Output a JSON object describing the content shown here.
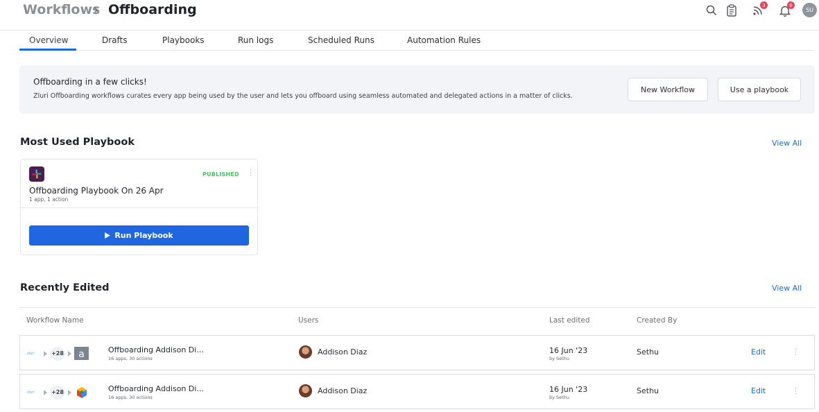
{
  "breadcrumb": {
    "root": "Workflows",
    "separator": "›",
    "current": "Offboarding"
  },
  "header": {
    "icons": [
      "search-icon",
      "clipboard-icon",
      "feed-icon",
      "bell-icon"
    ],
    "feed_badge": "3",
    "bell_badge": "6",
    "avatar_initials": "SU"
  },
  "tabs": [
    {
      "label": "Overview",
      "active": true
    },
    {
      "label": "Drafts"
    },
    {
      "label": "Playbooks"
    },
    {
      "label": "Run logs"
    },
    {
      "label": "Scheduled Runs"
    },
    {
      "label": "Automation Rules"
    }
  ],
  "banner": {
    "title": "Offboarding in a few clicks!",
    "description": "Zluri Offboarding workflows curates every app being used by the user and lets you offboard using seamless automated and delegated actions in a matter of clicks.",
    "new_workflow": "New Workflow",
    "use_playbook": "Use a playbook"
  },
  "most_used": {
    "title": "Most Used Playbook",
    "view_all": "View All",
    "card": {
      "app_icon": "slack-icon",
      "status": "PUBLISHED",
      "name": "Offboarding Playbook On 26 Apr",
      "meta": "1 app, 1 action",
      "run_label": "Run Playbook"
    }
  },
  "recently_edited": {
    "title": "Recently Edited",
    "view_all": "View All",
    "columns": [
      "Workflow Name",
      "Users",
      "Last edited",
      "Created By"
    ],
    "rows": [
      {
        "mini_logo": "zluri",
        "more_count": "+28",
        "app_icon": "letter-a-icon",
        "name": "Offboarding Addison Di...",
        "meta": "16 apps, 30 actions",
        "user": "Addison Diaz",
        "last_edited": "16 Jun '23",
        "last_edited_by": "by Sethu",
        "created_by": "Sethu",
        "edit": "Edit"
      },
      {
        "mini_logo": "zluri",
        "more_count": "+28",
        "app_icon": "cube-logo-icon",
        "name": "Offboarding Addison Di...",
        "meta": "16 apps, 30 actions",
        "user": "Addison Diaz",
        "last_edited": "16 Jun '23",
        "last_edited_by": "by Sethu",
        "created_by": "Sethu",
        "edit": "Edit"
      }
    ]
  },
  "colors": {
    "accent": "#1a6bd8",
    "primary_button": "#1f66e0",
    "published": "#40c463",
    "badge": "#e2455a"
  }
}
